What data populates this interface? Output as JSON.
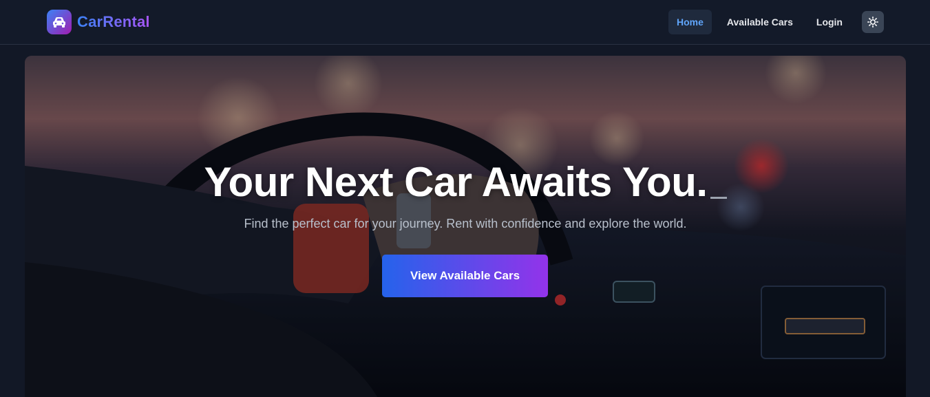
{
  "navbar": {
    "brand_name": "CarRental",
    "brand_icon": "car-icon",
    "links": [
      {
        "label": "Home",
        "active": true
      },
      {
        "label": "Available Cars",
        "active": false
      },
      {
        "label": "Login",
        "active": false
      }
    ],
    "theme_toggle_icon": "sun-icon"
  },
  "hero": {
    "title": "Your Next Car Awaits You.",
    "subtitle": "Find the perfect car for your journey. Rent with confidence and explore the world.",
    "cta_label": "View Available Cars"
  },
  "colors": {
    "page_bg": "#121826",
    "nav_active_bg": "#1f2a3d",
    "nav_active_text": "#60a5fa",
    "gradient_start": "#2563eb",
    "gradient_end": "#9333ea"
  }
}
